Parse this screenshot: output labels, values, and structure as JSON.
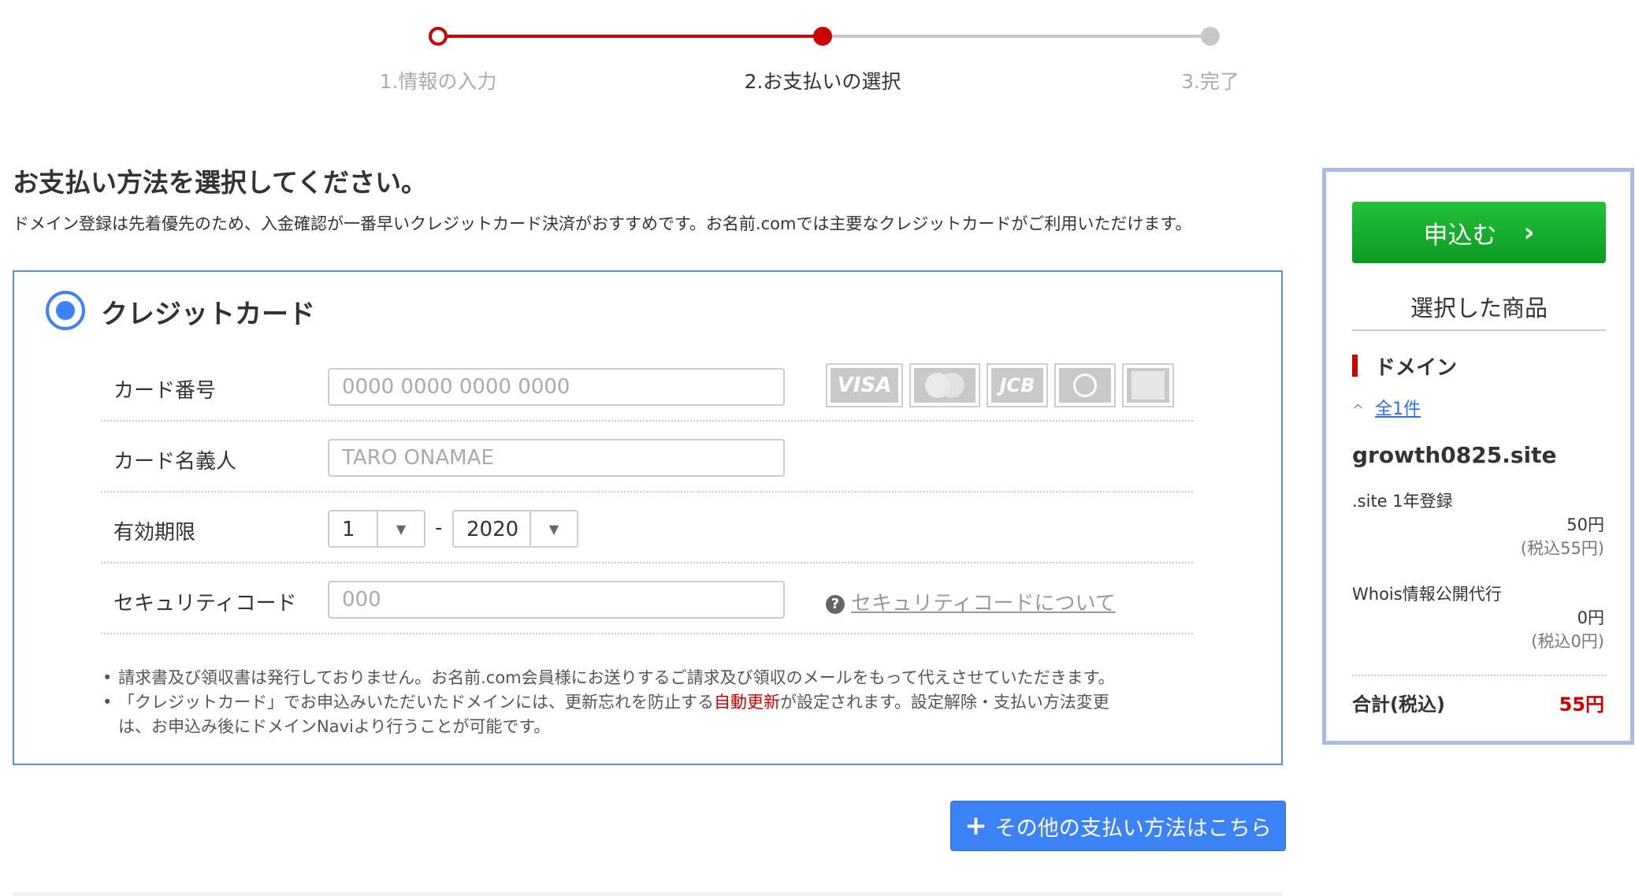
{
  "stepper": {
    "steps": [
      "1.情報の入力",
      "2.お支払いの選択",
      "3.完了"
    ],
    "current": 2
  },
  "page": {
    "title": "お支払い方法を選択してください。",
    "intro": "ドメイン登録は先着優先のため、入金確認が一番早いクレジットカード決済がおすすめです。お名前.comでは主要なクレジットカードがご利用いただけます。"
  },
  "credit_card": {
    "title": "クレジットカード",
    "selected": true,
    "card_number": {
      "label": "カード番号",
      "value": "",
      "placeholder": "0000 0000 0000 0000"
    },
    "brands": [
      "VISA",
      "mastercard",
      "JCB",
      "Diners Club",
      "AMERICAN EXPRESS"
    ],
    "card_holder": {
      "label": "カード名義人",
      "value": "",
      "placeholder": "TARO ONAMAE"
    },
    "expiry": {
      "label": "有効期限",
      "month": "1",
      "separator": "-",
      "year": "2020"
    },
    "security_code": {
      "label": "セキュリティコード",
      "value": "",
      "placeholder": "000",
      "help_link": "セキュリティコードについて"
    },
    "notes": {
      "note1": "請求書及び領収書は発行しておりません。お名前.com会員様にお送りするご請求及び領収のメールをもって代えさせていただきます。",
      "note2_pre": "「クレジットカード」でお申込みいただいたドメインには、更新忘れを防止する",
      "note2_highlight": "自動更新",
      "note2_mid": "が設定されます。設定解除・支払い方法変更",
      "note2_post": "は、お申込み後にドメインNaviより行うことが可能です。"
    }
  },
  "other_payment_button": "その他の支払い方法はこちら",
  "sidebar": {
    "apply_button": "申込む",
    "selected_items_title": "選択した商品",
    "domain_heading": "ドメイン",
    "count_link": "全1件",
    "domain_name": "growth0825.site",
    "items": [
      {
        "name": ".site 1年登録",
        "price": "50円",
        "tax_price": "(税込55円)"
      },
      {
        "name": "Whois情報公開代行",
        "price": "0円",
        "tax_price": "(税込0円)"
      }
    ],
    "total_label": "合計(税込)",
    "total_value": "55円"
  },
  "colors": {
    "accent_red": "#cc0000",
    "accent_blue": "#3b82f6",
    "apply_green": "#15a92a",
    "sidebar_border": "#a7bde6"
  },
  "icons": {
    "apply_arrow": "chevron-right-icon",
    "other_payment": "plus-icon",
    "help": "question-circle-icon",
    "select": "caret-down-icon"
  }
}
